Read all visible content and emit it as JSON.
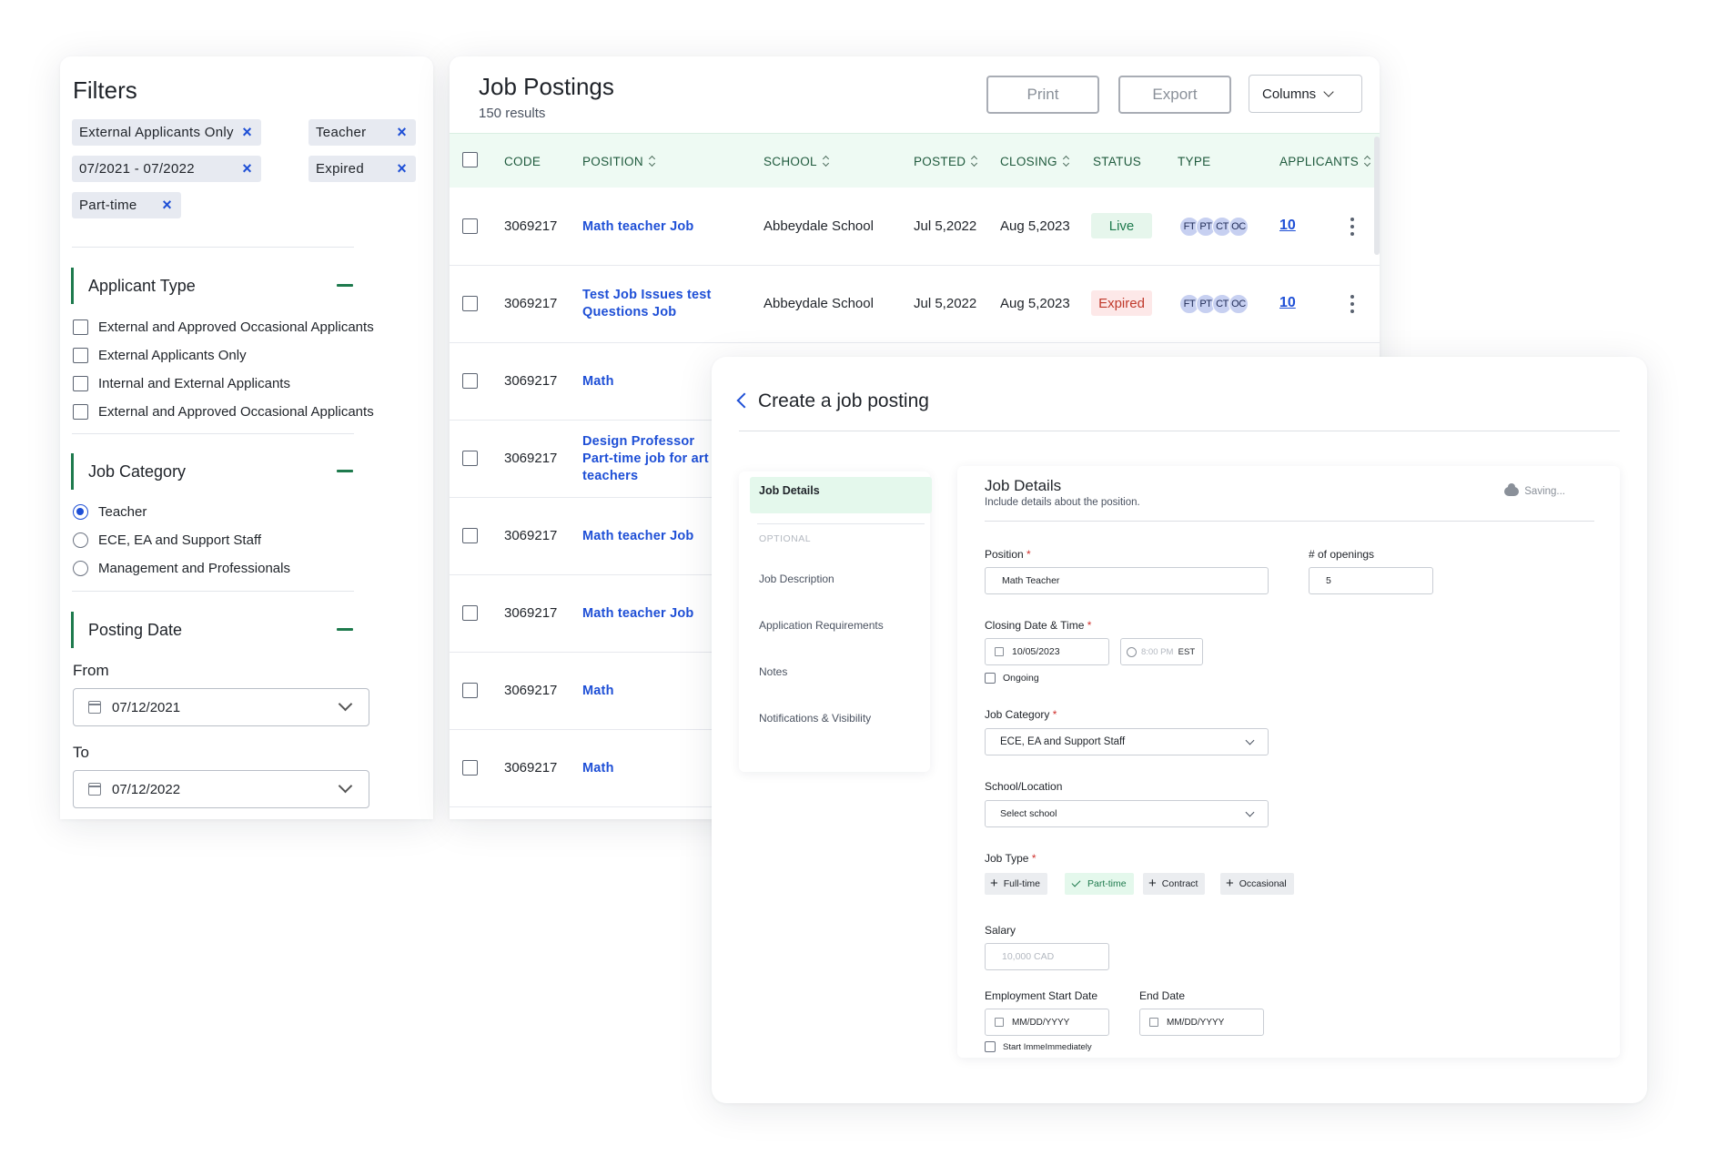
{
  "filters": {
    "title": "Filters",
    "chips": [
      "External Applicants Only",
      "Teacher",
      "07/2021 - 07/2022",
      "Expired",
      "Part-time"
    ],
    "remove_icon": "×",
    "applicant_type": {
      "heading": "Applicant Type",
      "options": [
        "External and Approved Occasional Applicants",
        "External Applicants Only",
        "Internal and External Applicants",
        "External and Approved Occasional Applicants"
      ]
    },
    "job_category": {
      "heading": "Job Category",
      "options": [
        "Teacher",
        "ECE, EA and Support Staff",
        "Management and Professionals"
      ],
      "selected": "Teacher"
    },
    "posting_date": {
      "heading": "Posting Date",
      "from_label": "From",
      "from_value": "07/12/2021",
      "to_label": "To",
      "to_value": "07/12/2022"
    }
  },
  "postings": {
    "title": "Job Postings",
    "results": "150 results",
    "print_label": "Print",
    "export_label": "Export",
    "columns_label": "Columns",
    "headers": {
      "code": "CODE",
      "position": "POSITION",
      "school": "SCHOOL",
      "posted": "POSTED",
      "closing": "CLOSING",
      "status": "STATUS",
      "type": "TYPE",
      "applicants": "APPLICANTS"
    },
    "type_tags": [
      "FT",
      "PT",
      "CT",
      "OC"
    ],
    "rows": [
      {
        "code": "3069217",
        "position": "Math teacher Job",
        "school": "Abbeydale School",
        "posted": "Jul 5,2022",
        "closing": "Aug 5,2023",
        "status": "Live",
        "applicants": "10"
      },
      {
        "code": "3069217",
        "position": "Test Job Issues test Questions Job",
        "school": "Abbeydale School",
        "posted": "Jul 5,2022",
        "closing": "Aug 5,2023",
        "status": "Expired",
        "applicants": "10"
      },
      {
        "code": "3069217",
        "position": "Math"
      },
      {
        "code": "3069217",
        "position": "Design Professor Part-time job for art teachers"
      },
      {
        "code": "3069217",
        "position": "Math teacher Job"
      },
      {
        "code": "3069217",
        "position": "Math teacher Job"
      },
      {
        "code": "3069217",
        "position": "Math"
      },
      {
        "code": "3069217",
        "position": "Math"
      }
    ],
    "colors": {
      "accent": "#1e4fd6",
      "header_bg": "#eefaf3",
      "live": "#1e7a4d",
      "expired": "#c0392b"
    }
  },
  "create": {
    "title": "Create a job posting",
    "nav": {
      "active": "Job Details",
      "optional_label": "OPTIONAL",
      "items": [
        "Job Description",
        "Application Requirements",
        "Notes",
        "Notifications & Visibility"
      ]
    },
    "form": {
      "title": "Job Details",
      "subtitle": "Include details about the position.",
      "saving": "Saving...",
      "position_label": "Position",
      "position_value": "Math Teacher",
      "openings_label": "# of openings",
      "openings_value": "5",
      "closing_label": "Closing Date & Time",
      "closing_date": "10/05/2023",
      "closing_time": "8:00 PM",
      "closing_tz": "EST",
      "ongoing_label": "Ongoing",
      "category_label": "Job Category",
      "category_value": "ECE, EA and Support Staff",
      "school_label": "School/Location",
      "school_placeholder": "Select school",
      "jobtype_label": "Job Type",
      "jobtypes": [
        "Full-time",
        "Part-time",
        "Contract",
        "Occasional"
      ],
      "jobtype_selected": "Part-time",
      "salary_label": "Salary",
      "salary_placeholder": "10,000 CAD",
      "start_label": "Employment Start Date",
      "start_placeholder": "MM/DD/YYYY",
      "end_label": "End Date",
      "end_placeholder": "MM/DD/YYYY",
      "start_immediately_label": "Start ImmeImmediately",
      "required_mark": "*"
    }
  }
}
